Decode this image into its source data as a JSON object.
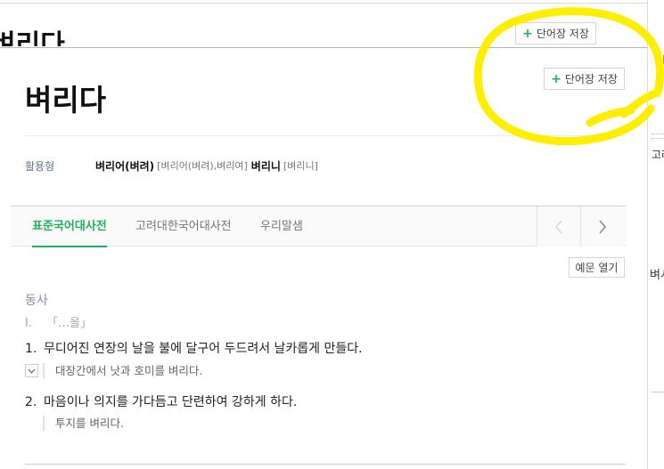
{
  "background": {
    "title_fragment": "벼리다",
    "save_label": "단어장 저장"
  },
  "side": {
    "text1": "고려",
    "text2": "벼시"
  },
  "entry": {
    "word": "벼리다",
    "save_label": "단어장 저장",
    "conjugation_label": "활용형",
    "conjugations": [
      {
        "form": "벼리어(벼려)",
        "pron": "[벼리어(벼려),벼리여]"
      },
      {
        "form": "벼리니",
        "pron": "[벼리니]"
      }
    ]
  },
  "tabs": [
    {
      "label": "표준국어대사전",
      "active": true
    },
    {
      "label": "고려대한국어대사전",
      "active": false
    },
    {
      "label": "우리말샘",
      "active": false
    }
  ],
  "nav_icons": {
    "prev": "chevron-left-icon",
    "next": "chevron-right-icon"
  },
  "example_toggle_label": "예문 열기",
  "part_of_speech": "동사",
  "pattern": {
    "roman": "I.",
    "text": "「…을」"
  },
  "definitions": [
    {
      "num": "1.",
      "text": "무디어진 연장의 날을 불에 달구어 두드려서 날카롭게 만들다.",
      "example": "대장간에서 낫과 호미를 벼리다."
    },
    {
      "num": "2.",
      "text": "마음이나 의지를 가다듬고 단련하여 강하게 하다.",
      "example": "투지를 벼리다."
    }
  ],
  "colors": {
    "accent_green": "#21b15b",
    "annotation_yellow": "#ffee00",
    "label_blue_gray": "#5c7a93"
  }
}
